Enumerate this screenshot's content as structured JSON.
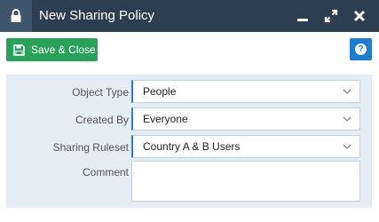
{
  "window": {
    "title": "New Sharing Policy",
    "lock_icon": "lock-icon",
    "minimize_icon": "minimize-icon",
    "maximize_icon": "expand-icon",
    "close_icon": "close-icon"
  },
  "toolbar": {
    "save_label": "Save & Close",
    "save_icon": "floppy-disk-icon",
    "help_icon": "question-circle-icon",
    "help_glyph": "?"
  },
  "form": {
    "object_type": {
      "label": "Object Type",
      "value": "People"
    },
    "created_by": {
      "label": "Created By",
      "value": "Everyone"
    },
    "sharing_ruleset": {
      "label": "Sharing Ruleset",
      "value": "Country A & B Users"
    },
    "comment": {
      "label": "Comment",
      "value": ""
    }
  },
  "colors": {
    "titlebar": "#2d3e50",
    "lock_box": "#3f556c",
    "save_button": "#2aa15a",
    "help_button": "#1f7ccf",
    "panel": "#e4ecf4",
    "field_accent": "#2b7cd0"
  }
}
